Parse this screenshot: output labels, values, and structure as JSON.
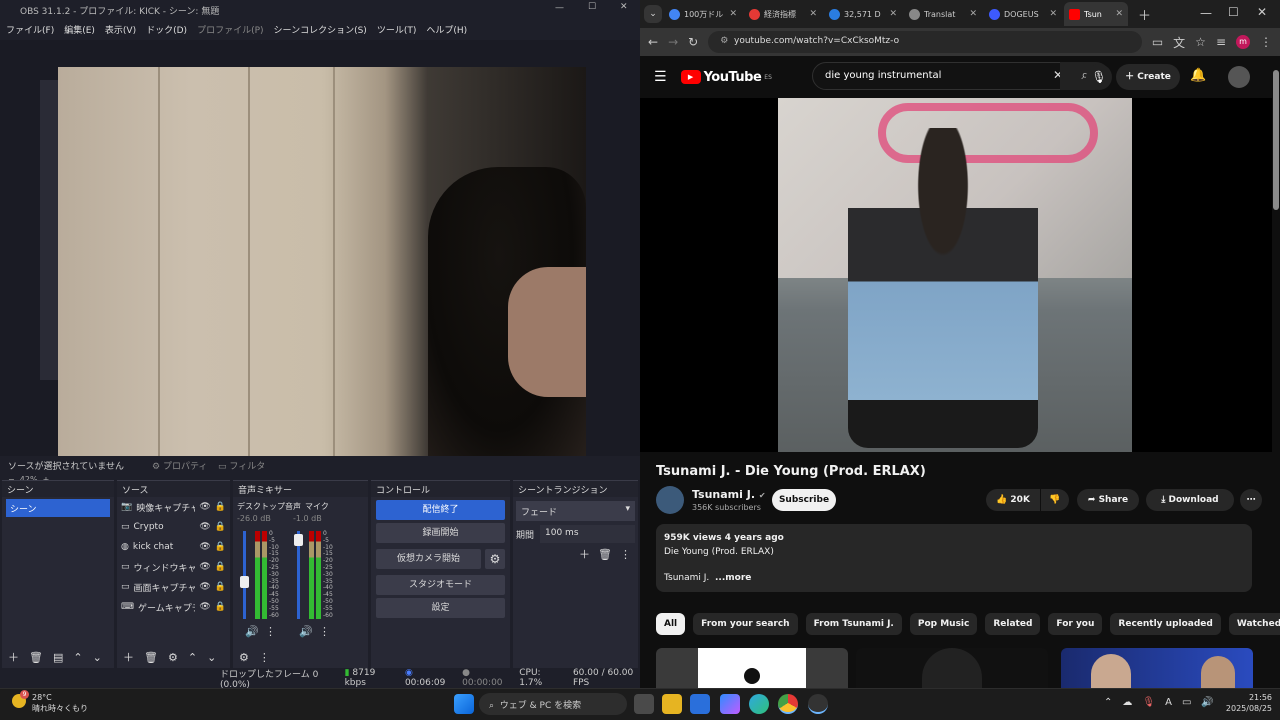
{
  "obs": {
    "title": "OBS 31.1.2 - プロファイル: KICK - シーン: 無題",
    "menu": [
      "ファイル(F)",
      "編集(E)",
      "表示(V)",
      "ドック(D)",
      "プロファイル(P)",
      "シーンコレクション(S)",
      "ツール(T)",
      "ヘルプ(H)"
    ],
    "zoom": "42%",
    "source_status": "ソースが選択されていません",
    "prop_label": "プロパティ",
    "filter_label": "フィルタ",
    "scenes": {
      "header": "シーン",
      "items": [
        "シーン"
      ]
    },
    "sources": {
      "header": "ソース",
      "items": [
        "映像キャプチャデ",
        "Crypto",
        "kick chat",
        "ウィンドウキャプ",
        "画面キャプチャ",
        "ゲームキャプチャ"
      ]
    },
    "mixer": {
      "header": "音声ミキサー",
      "channels": [
        {
          "name": "デスクトップ音声",
          "db": "-26.0 dB"
        },
        {
          "name": "マイク",
          "db": "-1.0 dB"
        }
      ],
      "scale": [
        "0",
        "-5",
        "-10",
        "-15",
        "-20",
        "-25",
        "-30",
        "-35",
        "-40",
        "-45",
        "-50",
        "-55",
        "-60"
      ]
    },
    "controls": {
      "header": "コントロール",
      "buttons": [
        "配信終了",
        "録画開始",
        "仮想カメラ開始",
        "スタジオモード",
        "設定"
      ]
    },
    "transitions": {
      "header": "シーントランジション",
      "type": "フェード",
      "duration_label": "期間",
      "duration": "100 ms"
    },
    "status": {
      "dropped": "ドロップしたフレーム 0 (0.0%)",
      "bitrate": "8719 kbps",
      "stream_time": "00:06:09",
      "rec_time": "00:00:00",
      "cpu": "CPU: 1.7%",
      "fps": "60.00 / 60.00 FPS"
    }
  },
  "chrome": {
    "tabs": [
      {
        "label": "100万ドル",
        "color": "#4285f4"
      },
      {
        "label": "経済指標",
        "color": "#e53935"
      },
      {
        "label": "32,571 D",
        "color": "#2a7de1"
      },
      {
        "label": "Translat",
        "color": "#888888"
      },
      {
        "label": "DOGEUS",
        "color": "#3d5afe"
      },
      {
        "label": "Tsun",
        "color": "#ff0000",
        "active": true
      }
    ],
    "url": "youtube.com/watch?v=CxCksoMtz-o"
  },
  "youtube": {
    "logo": "YouTube",
    "region": "ES",
    "search_query": "die young instrumental",
    "create_label": "Create",
    "video_title": "Tsunami J. - Die Young (Prod. ERLAX)",
    "channel": "Tsunami J.",
    "subscribers": "356K subscribers",
    "subscribe_label": "Subscribe",
    "likes": "20K",
    "share_label": "Share",
    "download_label": "Download",
    "views_line": "959K views  4 years ago",
    "desc_line": "Die Young (Prod. ERLAX)",
    "desc_channel": "Tsunami J.",
    "more_label": "...more",
    "chips": [
      "All",
      "From your search",
      "From Tsunami J.",
      "Pop Music",
      "Related",
      "For you",
      "Recently uploaded",
      "Watched"
    ]
  },
  "taskbar": {
    "weather_temp": "28°C",
    "weather_desc": "晴れ時々くもり",
    "weather_badge": "9",
    "search_placeholder": "ウェブ & PC を検索",
    "time": "21:56",
    "date": "2025/08/25",
    "ime": "A"
  }
}
